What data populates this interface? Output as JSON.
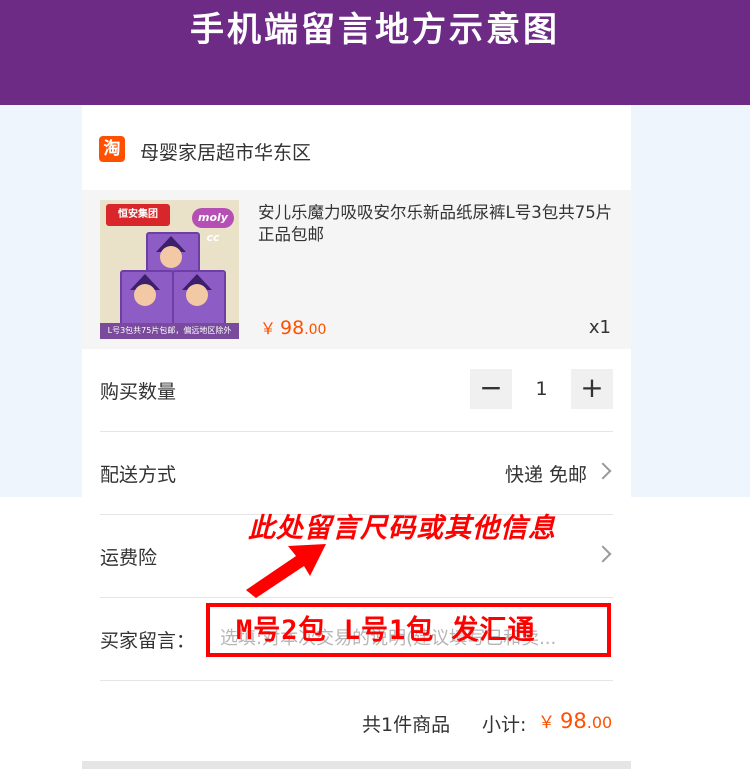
{
  "banner": {
    "title": "手机端留言地方示意图"
  },
  "shop": {
    "icon_text": "淘",
    "name": "母婴家居超市华东区"
  },
  "item": {
    "thumb_logo": "恒安集团",
    "thumb_brand": "moly cc",
    "thumb_caption": "L号3包共75片包邮，偏远地区除外",
    "title": "安儿乐魔力吸吸安尔乐新品纸尿裤L号3包共75片正品包邮",
    "currency": "￥",
    "price_int": "98",
    "price_dec": ".00",
    "quantity": "x1"
  },
  "buy_quantity": {
    "label": "购买数量",
    "minus": "−",
    "value": "1",
    "plus": "+"
  },
  "delivery": {
    "label": "配送方式",
    "value": "快递 免邮"
  },
  "shipping_insurance": {
    "label": "运费险"
  },
  "buyer_message": {
    "label": "买家留言：",
    "placeholder": "选填:对本次交易的说明(建议填写已和卖..."
  },
  "annotation": {
    "hint": "此处留言尺码或其他信息",
    "example": "M号2包 L号1包  发汇通"
  },
  "summary": {
    "count_text": "共1件商品",
    "subtotal_label": "小计:",
    "currency": "￥",
    "price_int": "98",
    "price_dec": ".00"
  },
  "colors": {
    "banner": "#6e2b86",
    "accent": "#ff5000",
    "annotation": "#ff0000",
    "side_background": "#eef5fd"
  },
  "icons": [
    "taobao-icon",
    "chevron-right-icon",
    "minus-icon",
    "plus-icon",
    "arrow-icon"
  ]
}
